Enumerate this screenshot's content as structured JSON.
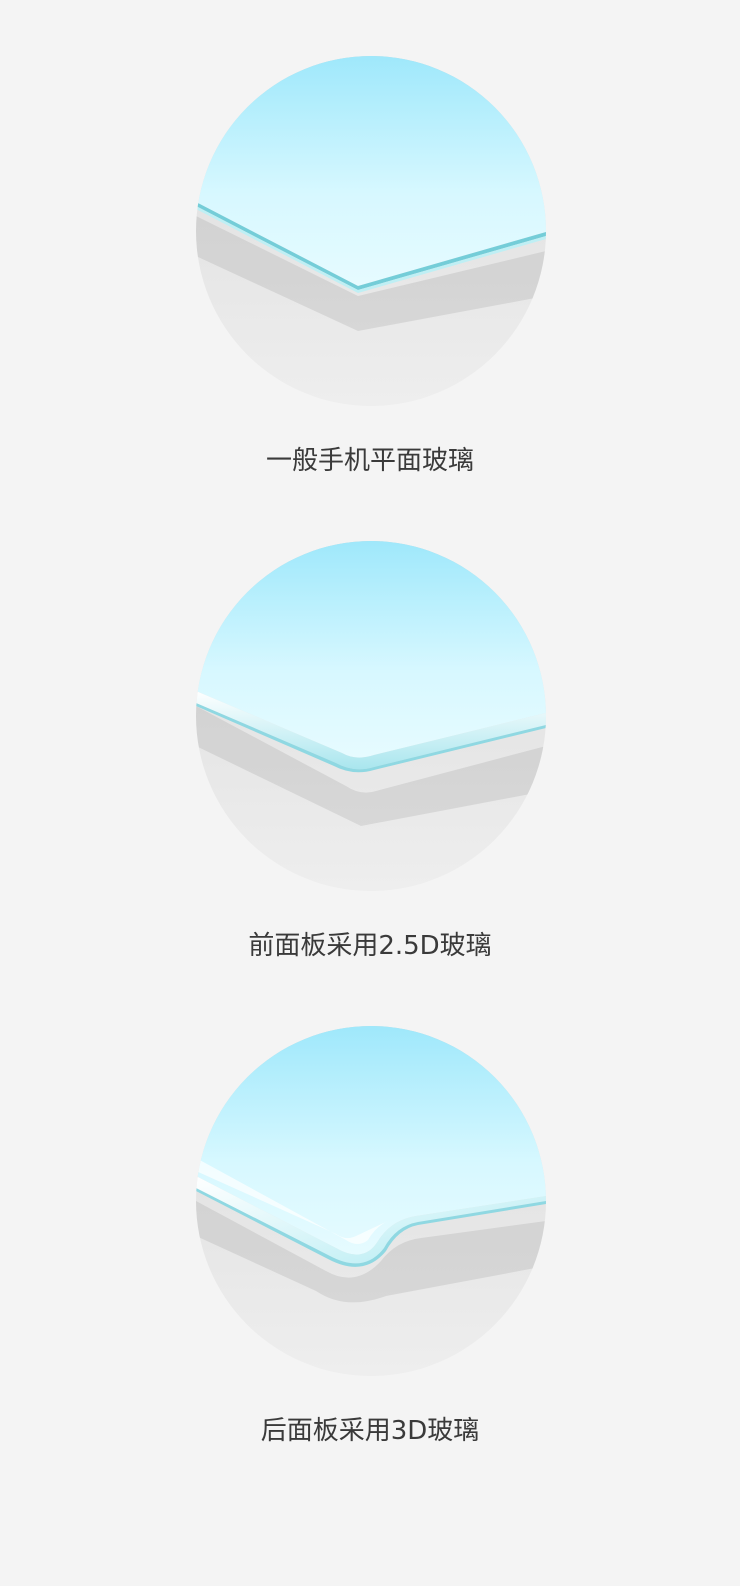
{
  "colors": {
    "background": "#f4f4f4",
    "glass_top": "#9fe8fb",
    "glass_bottom": "#dffaff",
    "glass_edge": "#74cdd8",
    "body_light": "#f0f0f0",
    "body_dark": "#c9c9c9",
    "caption_text": "#3a3a3a"
  },
  "items": [
    {
      "caption": "一般手机平面玻璃",
      "illustration": "flat-glass-illustration"
    },
    {
      "caption": "前面板采用2.5D玻璃",
      "illustration": "2.5d-glass-illustration"
    },
    {
      "caption": "后面板采用3D玻璃",
      "illustration": "3d-glass-illustration"
    }
  ]
}
